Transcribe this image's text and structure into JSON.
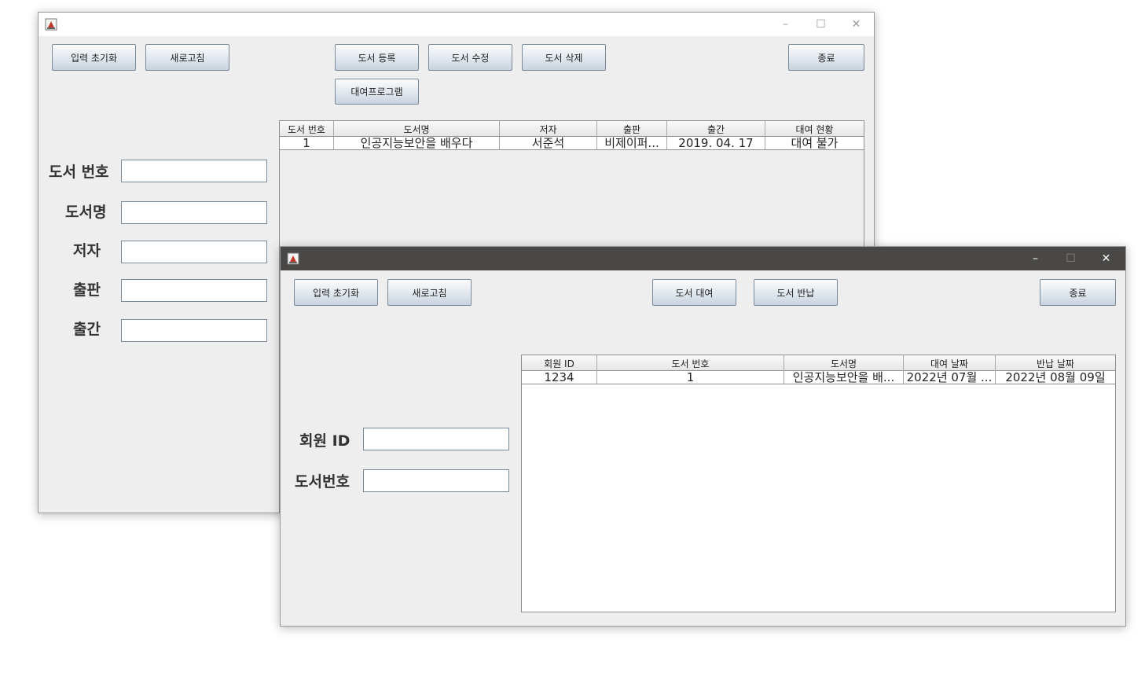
{
  "book_window": {
    "toolbar": {
      "reset_label": "입력 초기화",
      "refresh_label": "새로고침",
      "register_label": "도서 등록",
      "edit_label": "도서 수정",
      "delete_label": "도서 삭제",
      "exit_label": "종료",
      "rental_program_label": "대여프로그램"
    },
    "form": {
      "book_no_label": "도서 번호",
      "title_label": "도서명",
      "author_label": "저자",
      "publisher_label": "출판",
      "pub_date_label": "출간"
    },
    "table": {
      "columns": [
        "도서 번호",
        "도서명",
        "저자",
        "출판",
        "출간",
        "대여 현황"
      ],
      "rows": [
        [
          "1",
          "인공지능보안을 배우다",
          "서준석",
          "비제이퍼...",
          "2019. 04. 17",
          "대여 불가"
        ]
      ]
    }
  },
  "rental_window": {
    "toolbar": {
      "reset_label": "입력 초기화",
      "refresh_label": "새로고침",
      "rent_label": "도서 대여",
      "return_label": "도서 반납",
      "exit_label": "종료"
    },
    "form": {
      "member_id_label": "회원 ID",
      "book_no_label": "도서번호"
    },
    "table": {
      "columns": [
        "회원 ID",
        "도서 번호",
        "도서명",
        "대여 날짜",
        "반납 날짜"
      ],
      "rows": [
        [
          "1234",
          "1",
          "인공지능보안을 배...",
          "2022년 07월 ...",
          "2022년 08월 09일"
        ]
      ]
    }
  },
  "icons": {
    "app": "java-app-icon",
    "minimize": "minimize-icon",
    "maximize": "maximize-icon",
    "close": "close-icon"
  },
  "colors": {
    "active_titlebar": "#4a4846",
    "inactive_titlebar": "#ffffff",
    "window_bg": "#eeeeee"
  }
}
